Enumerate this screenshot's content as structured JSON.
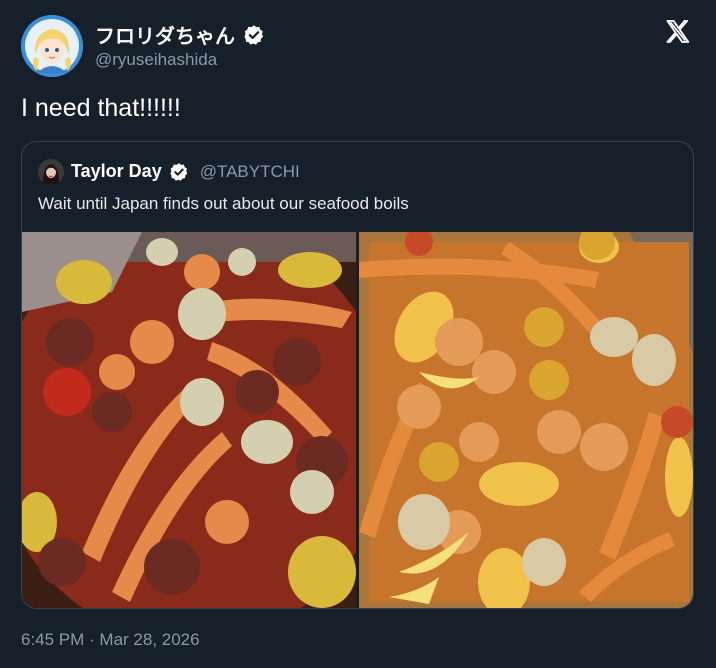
{
  "tweet": {
    "author_name": "フロリダちゃん",
    "author_handle": "@ryuseihashida",
    "text": "I need that!!!!!!",
    "timestamp": "6:45 PM · Mar 28, 2026"
  },
  "quoted": {
    "author_name": "Taylor Day",
    "author_handle": "@TABYTCHI",
    "text": "Wait until Japan finds out about our seafood boils"
  },
  "icons": {
    "verified": "verified-badge-icon",
    "platform": "x-logo-icon"
  },
  "colors": {
    "background": "#15202b",
    "text": "#e7e9ea",
    "secondary_text": "#8b98a5",
    "border": "#38444d"
  }
}
